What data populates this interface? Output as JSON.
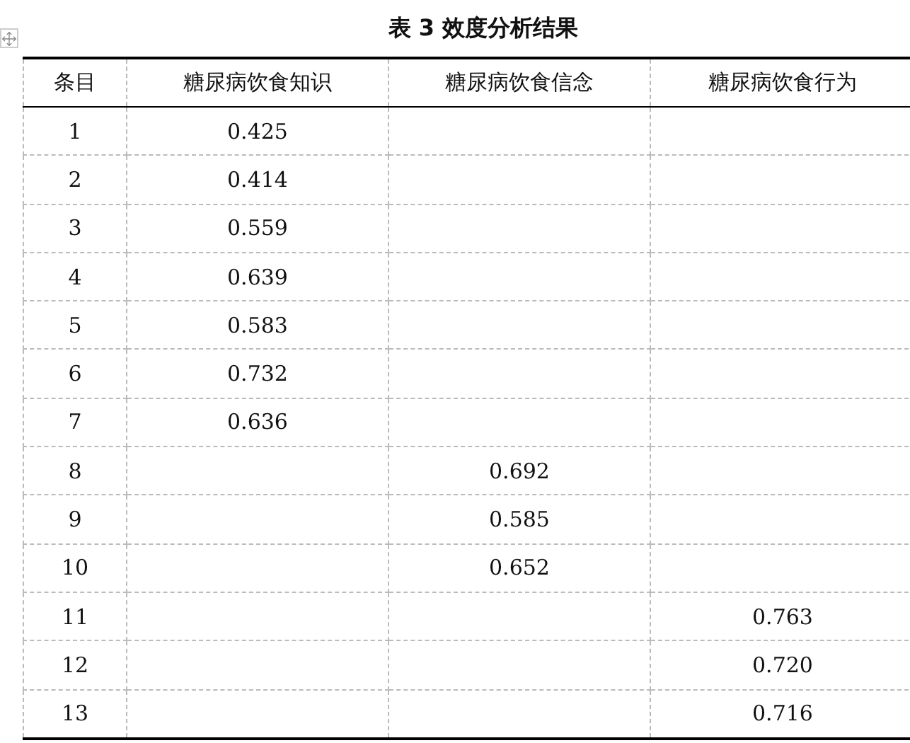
{
  "title": "表 3 效度分析结果",
  "columns": [
    "条目",
    "糖尿病饮食知识",
    "糖尿病饮食信念",
    "糖尿病饮食行为"
  ],
  "rows": [
    {
      "item": "1",
      "kind": "knowledge",
      "value": "0.425"
    },
    {
      "item": "2",
      "kind": "knowledge",
      "value": "0.414"
    },
    {
      "item": "3",
      "kind": "knowledge",
      "value": "0.559"
    },
    {
      "item": "4",
      "kind": "knowledge",
      "value": "0.639"
    },
    {
      "item": "5",
      "kind": "knowledge",
      "value": "0.583"
    },
    {
      "item": "6",
      "kind": "knowledge",
      "value": "0.732"
    },
    {
      "item": "7",
      "kind": "knowledge",
      "value": "0.636"
    },
    {
      "item": "8",
      "kind": "belief",
      "value": "0.692"
    },
    {
      "item": "9",
      "kind": "belief",
      "value": "0.585"
    },
    {
      "item": "10",
      "kind": "belief",
      "value": "0.652"
    },
    {
      "item": "11",
      "kind": "behavior",
      "value": "0.763"
    },
    {
      "item": "12",
      "kind": "behavior",
      "value": "0.720"
    },
    {
      "item": "13",
      "kind": "behavior",
      "value": "0.716"
    }
  ]
}
